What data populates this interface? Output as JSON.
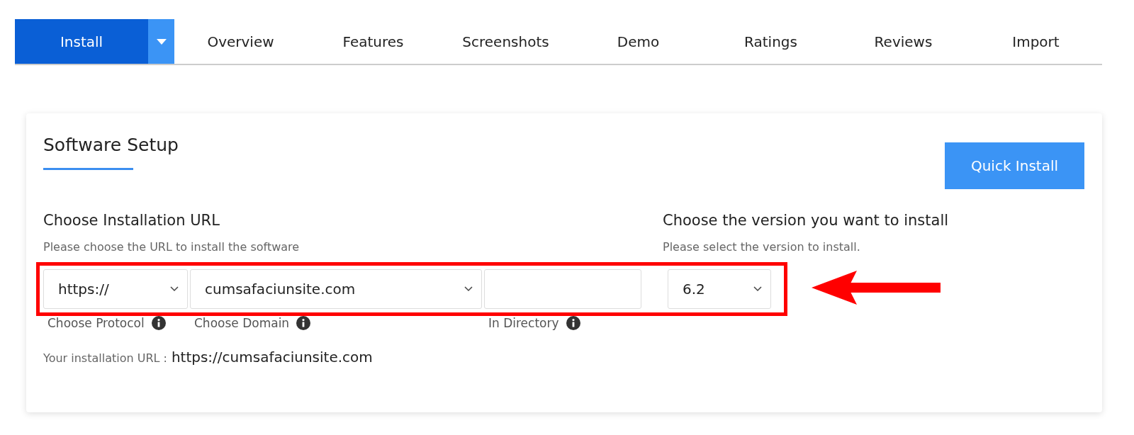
{
  "tabs": [
    {
      "label": "Install",
      "selected": true,
      "has_menu": true
    },
    {
      "label": "Overview",
      "selected": false
    },
    {
      "label": "Features",
      "selected": false
    },
    {
      "label": "Screenshots",
      "selected": false
    },
    {
      "label": "Demo",
      "selected": false
    },
    {
      "label": "Ratings",
      "selected": false
    },
    {
      "label": "Reviews",
      "selected": false
    },
    {
      "label": "Import",
      "selected": false
    }
  ],
  "setup": {
    "title": "Software Setup",
    "quick_install": "Quick Install",
    "url_section": {
      "heading": "Choose Installation URL",
      "hint": "Please choose the URL to install the software"
    },
    "version_section": {
      "heading": "Choose the version you want to install",
      "hint": "Please select the version to install."
    },
    "fields": [
      {
        "kind": "select",
        "value": "https://",
        "label": "Choose Protocol",
        "info": true
      },
      {
        "kind": "select",
        "value": "cumsafaciunsite.com",
        "label": "Choose Domain",
        "info": true
      },
      {
        "kind": "text",
        "label": "In Directory",
        "info": true
      },
      {
        "kind": "select",
        "value": "6.2"
      }
    ],
    "install_url_label": "Your installation URL :",
    "install_url": "https://cumsafaciunsite.com"
  },
  "annotation": {
    "highlight": true,
    "arrow": true
  }
}
